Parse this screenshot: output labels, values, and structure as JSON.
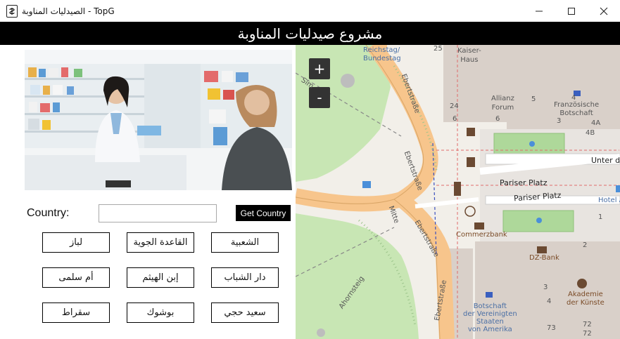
{
  "window": {
    "title": "الصيدليات المناوبة - TopG",
    "controls": {
      "minimize": "—",
      "maximize": "☐",
      "close": "✕"
    }
  },
  "banner": {
    "title": "مشروع صيدليات المناوبة"
  },
  "country": {
    "label": "Country:",
    "value": "",
    "button": "Get Country"
  },
  "locations": [
    "لباز",
    "القاعدة الجوية",
    "الشعبية",
    "أم سلمى",
    "إبن الهيثم",
    "دار الشباب",
    "سقراط",
    "بوشوك",
    "سعيد حجي"
  ],
  "map": {
    "zoom_in": "+",
    "zoom_out": "-",
    "labels": {
      "reichstag": "Reichstag/\nBundestag",
      "kaiser": "Kaiser-\nHaus",
      "allianz": "Allianz\nForum",
      "franz": "Französische\nBotschaft",
      "unter": "Unter de",
      "pariser1": "Pariser Platz",
      "pariser2": "Pariser Platz",
      "hotel": "Hotel A",
      "commerzbank": "Commerzbank",
      "dzbank": "DZ-Bank",
      "akademie": "Akademie\nder Künste",
      "botschaft": "Botschaft\nder Vereinigten\nStaaten\nvon Amerika",
      "ebert1": "Ebertstraße",
      "ebert2": "Ebertstraße",
      "ebert3": "Ebertstraße",
      "ebert4": "Ebertstraße",
      "ahornsteig": "Ahornsteig",
      "mitte": "Mitte",
      "simson": "Sim",
      "n25": "25",
      "n24": "24",
      "n5": "5",
      "n6a": "6",
      "n6b": "6",
      "n3": "3",
      "n4": "4",
      "n4a": "4A",
      "n4b": "4B",
      "n1": "1",
      "n2": "2",
      "n3b": "3",
      "n4c": "4",
      "n73": "73",
      "n72a": "72",
      "n72b": "72"
    }
  }
}
